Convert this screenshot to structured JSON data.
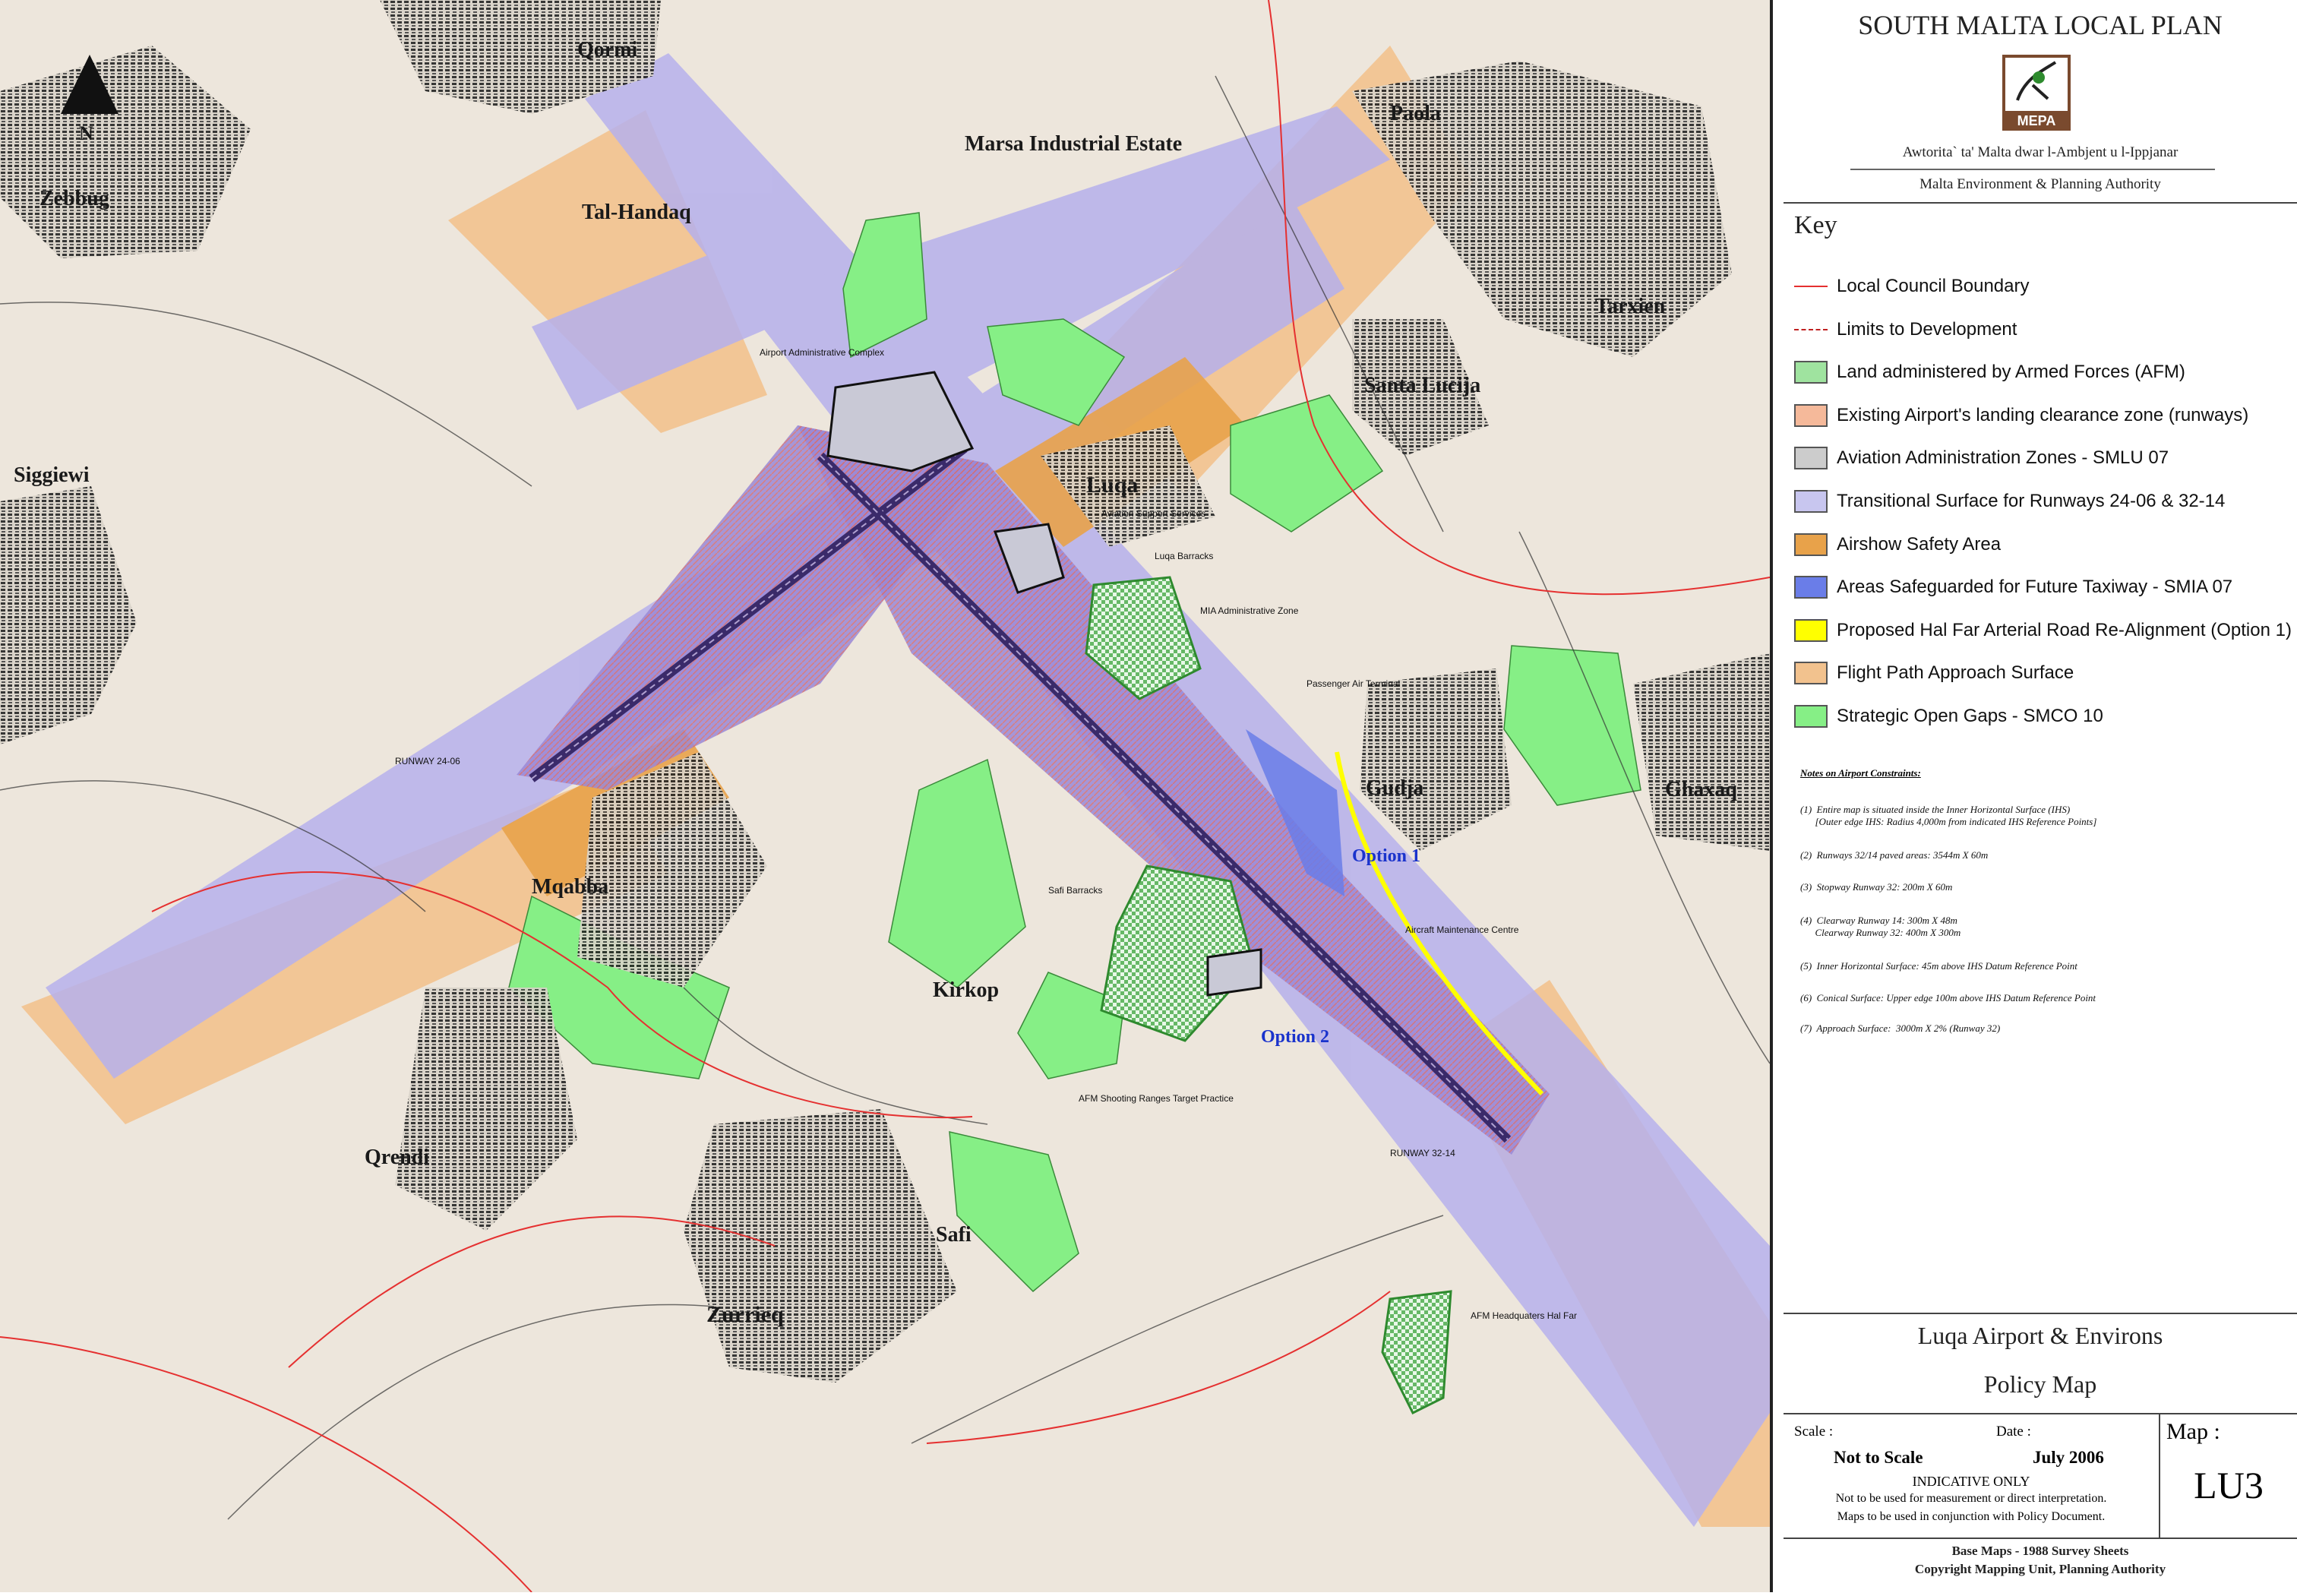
{
  "header": {
    "plan_title": "SOUTH MALTA LOCAL PLAN",
    "logo_text": "MEPA",
    "authority_mt": "Awtorita` ta' Malta dwar l-Ambjent u l-Ippjanar",
    "authority_en": "Malta Environment & Planning Authority"
  },
  "key": {
    "heading": "Key",
    "items": [
      {
        "label": "Local Council Boundary",
        "style": "line",
        "color": "#e53030"
      },
      {
        "label": "Limits to Development",
        "style": "dashdot",
        "color": "#c02020"
      },
      {
        "label": "Land administered by Armed Forces (AFM)",
        "style": "fill",
        "color": "#9fe39f"
      },
      {
        "label": "Existing Airport's landing clearance zone (runways)",
        "style": "fill",
        "color": "#f5b99a"
      },
      {
        "label": "Aviation Administration Zones - SMLU 07",
        "style": "fill",
        "color": "#cccccc"
      },
      {
        "label": "Transitional Surface for Runways 24-06 & 32-14",
        "style": "fill",
        "color": "#c8c6ef"
      },
      {
        "label": "Airshow Safety Area",
        "style": "fill",
        "color": "#e8a24a"
      },
      {
        "label": "Areas Safeguarded for Future Taxiway - SMIA 07",
        "style": "fill",
        "color": "#6a7de8"
      },
      {
        "label": "Proposed Hal Far Arterial Road Re-Alignment (Option 1)",
        "style": "fill",
        "color": "#ffff00"
      },
      {
        "label": "Flight Path Approach Surface",
        "style": "fill",
        "color": "#f2c28e"
      },
      {
        "label": "Strategic Open Gaps - SMCO 10",
        "style": "fill",
        "color": "#86ef86"
      }
    ]
  },
  "notes": {
    "heading": "Notes on Airport Constraints:",
    "items": [
      "(1)  Entire map is situated inside the Inner Horizontal Surface (IHS)",
      "      [Outer edge IHS: Radius 4,000m from indicated IHS Reference Points]",
      "(2)  Runways 32/14 paved areas: 3544m X 60m",
      "(3)  Stopway Runway 32: 200m X 60m",
      "(4)  Clearway Runway 14: 300m X 48m",
      "      Clearway Runway 32: 400m X 300m",
      "(5)  Inner Horizontal Surface: 45m above IHS Datum Reference Point",
      "(6)  Conical Surface: Upper edge 100m above IHS Datum Reference Point",
      "(7)  Approach Surface:  3000m X 2% (Runway 32)"
    ]
  },
  "title_block": {
    "title_line1": "Luqa Airport & Environs",
    "title_line2": "Policy Map",
    "scale_label": "Scale :",
    "scale_value": "Not to Scale",
    "date_label": "Date :",
    "date_value": "July 2006",
    "indicative": "INDICATIVE ONLY",
    "disclaimer1": "Not to be used for measurement or direct interpretation.",
    "disclaimer2": "Maps to be used in conjunction with Policy Document.",
    "map_label": "Map :",
    "map_id": "LU3",
    "base_maps": "Base Maps - 1988 Survey Sheets",
    "copyright": "Copyright Mapping Unit, Planning Authority"
  },
  "map": {
    "north_label": "N",
    "places": [
      "Qormi",
      "Marsa Industrial Estate",
      "Paola",
      "Zebbug",
      "Tal-Handaq",
      "Tarxien",
      "Santa Lucija",
      "Siggiewi",
      "Luqa",
      "Gudja",
      "Ghaxaq",
      "Mqabba",
      "Kirkop",
      "Qrendi",
      "Safi",
      "Zurrieq"
    ],
    "features": [
      "Airport Administrative Complex",
      "Aviation Support Services",
      "Luqa Barracks",
      "MIA Administrative Zone",
      "Passenger Air Terminal",
      "Aircraft Maintenance Centre",
      "Safi Barracks",
      "AFM Shooting Ranges Target Practice",
      "AFM Headquaters Hal Far"
    ],
    "runway_labels": [
      "RUNWAY 24-06",
      "RUNWAY 32-14"
    ],
    "options": [
      "Option 1",
      "Option 2"
    ]
  }
}
